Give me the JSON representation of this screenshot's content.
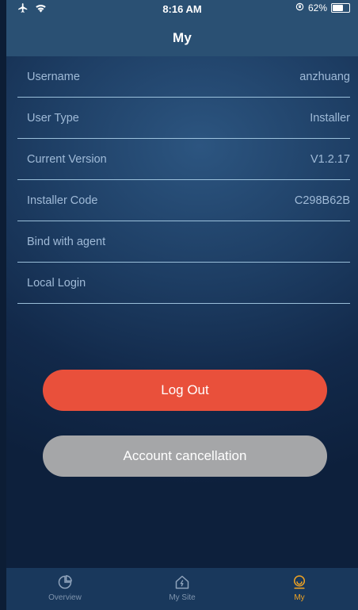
{
  "status_bar": {
    "time": "8:16 AM",
    "battery_percent": "62%",
    "icons": [
      "airplane-icon",
      "wifi-icon",
      "rotation-lock-icon",
      "battery-icon"
    ]
  },
  "header": {
    "title": "My"
  },
  "profile": {
    "rows": [
      {
        "label": "Username",
        "value": "anzhuang"
      },
      {
        "label": "User Type",
        "value": "Installer"
      },
      {
        "label": "Current Version",
        "value": "V1.2.17"
      },
      {
        "label": "Installer Code",
        "value": "C298B62B"
      },
      {
        "label": "Bind with agent",
        "value": ""
      },
      {
        "label": "Local Login",
        "value": ""
      }
    ]
  },
  "actions": {
    "logout_label": "Log Out",
    "cancel_label": "Account cancellation"
  },
  "tabbar": {
    "tabs": [
      {
        "label": "Overview",
        "icon": "overview-icon"
      },
      {
        "label": "My Site",
        "icon": "home-icon"
      },
      {
        "label": "My",
        "icon": "profile-icon",
        "active": true
      }
    ]
  },
  "colors": {
    "accent": "#f3a522",
    "logout": "#e9503b",
    "cancel": "#a5a6a8",
    "navbar": "#2a5073"
  }
}
